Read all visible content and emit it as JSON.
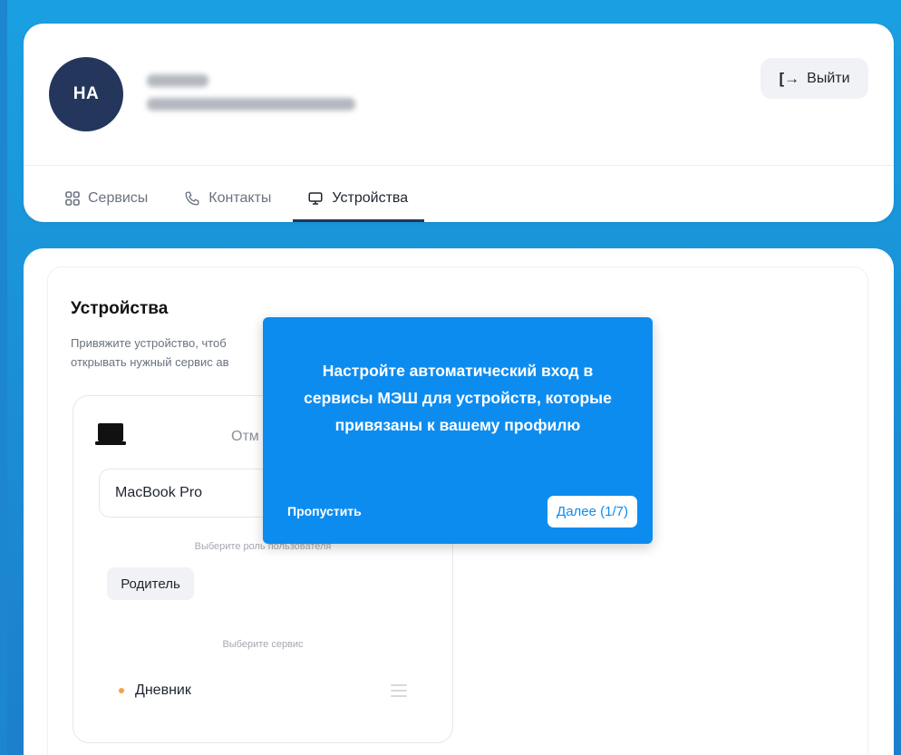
{
  "header": {
    "avatar_initials": "НА",
    "logout_label": "Выйти"
  },
  "tabs": [
    {
      "label": "Сервисы",
      "icon": "grid-icon",
      "active": false
    },
    {
      "label": "Контакты",
      "icon": "phone-icon",
      "active": false
    },
    {
      "label": "Устройства",
      "icon": "monitor-icon",
      "active": true
    }
  ],
  "devices": {
    "title": "Устройства",
    "description": "Привяжите устройство, чтоб открывать нужный сервис ав",
    "card": {
      "cancel_label": "Отм",
      "device_name": "MacBook Pro",
      "role_label": "Выберите роль пользователя",
      "role_value": "Родитель",
      "service_label": "Выберите сервис",
      "service_value": "Дневник"
    }
  },
  "tooltip": {
    "text": "Настройте автоматический вход в сервисы МЭШ для устройств, которые привязаны к вашему профилю",
    "skip_label": "Пропустить",
    "next_label": "Далее (1/7)"
  },
  "colors": {
    "accent": "#0d8cf0",
    "avatar_bg": "#24365c",
    "service_dot": "#f5a04a"
  }
}
